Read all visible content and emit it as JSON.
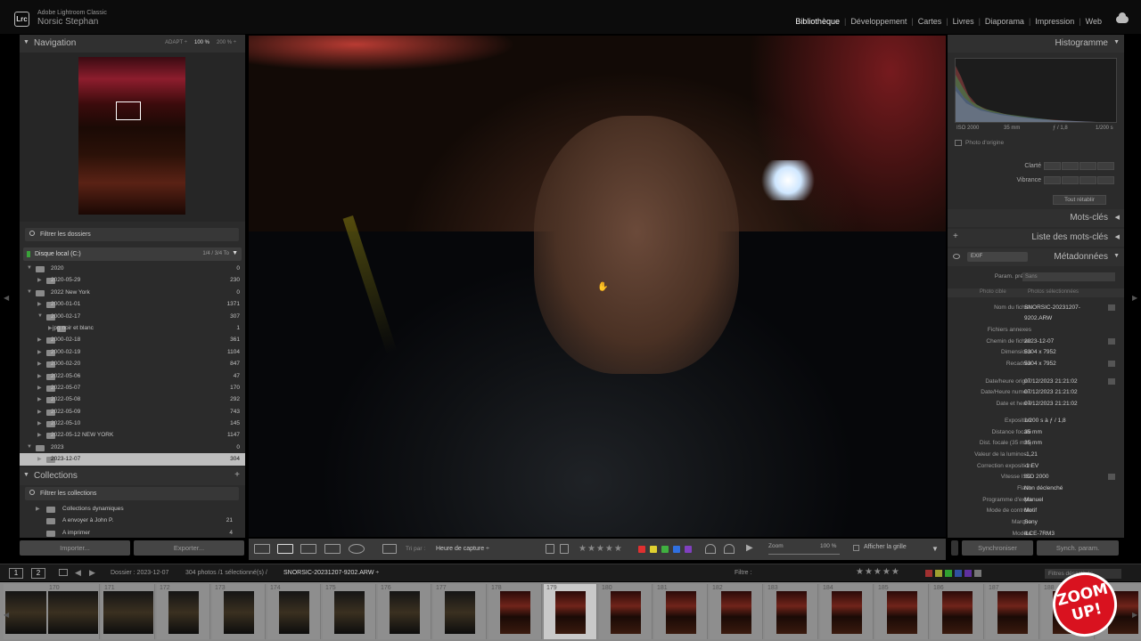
{
  "app": {
    "logo": "Lrc",
    "name": "Adobe Lightroom Classic",
    "user": "Norsic Stephan"
  },
  "modules": [
    {
      "label": "Bibliothèque",
      "active": true
    },
    {
      "label": "Développement",
      "active": false
    },
    {
      "label": "Cartes",
      "active": false
    },
    {
      "label": "Livres",
      "active": false
    },
    {
      "label": "Diaporama",
      "active": false
    },
    {
      "label": "Impression",
      "active": false
    },
    {
      "label": "Web",
      "active": false
    }
  ],
  "navigator": {
    "title": "Navigation",
    "zoom_options": [
      "ADAPT ÷",
      "100 %",
      "200 % ÷"
    ]
  },
  "folders": {
    "filter_placeholder": "Filtrer les dossiers",
    "disk": {
      "label": "Disque local (C:)",
      "size": "1/4 / 3/4 To"
    },
    "rows": [
      {
        "name": "2020",
        "count": "0",
        "level": 0,
        "expanded": true
      },
      {
        "name": "2020-05-29",
        "count": "230",
        "level": 1,
        "expanded": false
      },
      {
        "name": "2022 New York",
        "count": "0",
        "level": 0,
        "expanded": true
      },
      {
        "name": "2000-01-01",
        "count": "1371",
        "level": 1,
        "expanded": false
      },
      {
        "name": "2000-02-17",
        "count": "307",
        "level": 1,
        "expanded": true
      },
      {
        "name": "jpg noir et blanc",
        "count": "1",
        "level": 2,
        "expanded": false
      },
      {
        "name": "2000-02-18",
        "count": "361",
        "level": 1,
        "expanded": false
      },
      {
        "name": "2000-02-19",
        "count": "1104",
        "level": 1,
        "expanded": false
      },
      {
        "name": "2000-02-20",
        "count": "847",
        "level": 1,
        "expanded": false
      },
      {
        "name": "2022-05-06",
        "count": "47",
        "level": 1,
        "expanded": false
      },
      {
        "name": "2022-05-07",
        "count": "170",
        "level": 1,
        "expanded": false
      },
      {
        "name": "2022-05-08",
        "count": "292",
        "level": 1,
        "expanded": false
      },
      {
        "name": "2022-05-09",
        "count": "743",
        "level": 1,
        "expanded": false
      },
      {
        "name": "2022-05-10",
        "count": "145",
        "level": 1,
        "expanded": false
      },
      {
        "name": "2022-05-12 NEW YORK",
        "count": "1147",
        "level": 1,
        "expanded": false
      },
      {
        "name": "2023",
        "count": "0",
        "level": 0,
        "expanded": true
      },
      {
        "name": "2023-12-07",
        "count": "304",
        "level": 1,
        "expanded": false,
        "selected": true
      }
    ]
  },
  "collections": {
    "title": "Collections",
    "filter_placeholder": "Filtrer les collections",
    "rows": [
      {
        "name": "Collections dynamiques",
        "count": ""
      },
      {
        "name": "A envoyer à John P.",
        "count": "21"
      },
      {
        "name": "A imprimer",
        "count": "4"
      }
    ]
  },
  "left_buttons": {
    "import": "Importer...",
    "export": "Exporter..."
  },
  "toolbar": {
    "sort_label": "Tri par :",
    "sort_value": "Heure de capture ÷",
    "stars": "★★★★★",
    "zoom_label": "Zoom",
    "zoom_value": "100 %",
    "grid_label": "Afficher la grille",
    "label_colors": [
      "#e03030",
      "#e0d030",
      "#40b040",
      "#3070e0",
      "#8040c0"
    ]
  },
  "histogram": {
    "title": "Histogramme",
    "iso": "ISO 2000",
    "focal": "35 mm",
    "aperture": "ƒ / 1,8",
    "shutter": "1/200 s",
    "original_label": "Photo d'origine"
  },
  "quick_develop": {
    "rows": [
      {
        "label": "Clarté"
      },
      {
        "label": "Vibrance"
      }
    ],
    "reset": "Tout rétablir"
  },
  "keywords": {
    "title": "Mots-clés"
  },
  "keyword_list": {
    "title": "Liste des mots-clés"
  },
  "metadata": {
    "title": "Métadonnées",
    "set": "EXIF",
    "preset_label": "Param. prédéf",
    "preset_value": "Sans",
    "tab_photo": "Photo cible",
    "tab_selected": "Photos sélectionnées",
    "rows": [
      {
        "k": "Nom du fichier",
        "v": "SNORSIC-20231207-",
        "btn": true
      },
      {
        "k": "",
        "v": "9202.ARW",
        "btn": false
      },
      {
        "k": "Fichiers annexes",
        "v": "",
        "btn": false
      },
      {
        "k": "Chemin de fichier",
        "v": "2023-12-07",
        "btn": true
      },
      {
        "k": "Dimensions",
        "v": "5304 x 7952",
        "btn": false
      },
      {
        "k": "Recadrée",
        "v": "5304 x 7952",
        "btn": true
      },
      {
        "k": "Date/heure origin.",
        "v": "07/12/2023 21:21:02",
        "btn": true
      },
      {
        "k": "Date/Heure numéri.",
        "v": "07/12/2023 21:21:02",
        "btn": false
      },
      {
        "k": "Date et heure",
        "v": "07/12/2023 21:21:02",
        "btn": false
      },
      {
        "k": "Exposition",
        "v": "1/200 s à ƒ / 1,8",
        "btn": false
      },
      {
        "k": "Distance focale",
        "v": "35 mm",
        "btn": false
      },
      {
        "k": "Dist. focale (35 mm)",
        "v": "35 mm",
        "btn": false
      },
      {
        "k": "Valeur de la luminos...",
        "v": "-1,21",
        "btn": false
      },
      {
        "k": "Correction exposition",
        "v": "-1 EV",
        "btn": false
      },
      {
        "k": "Vitesse ISO",
        "v": "ISO 2000",
        "btn": true
      },
      {
        "k": "Flash",
        "v": "Non déclenché",
        "btn": false
      },
      {
        "k": "Programme d'expo",
        "v": "Manuel",
        "btn": false
      },
      {
        "k": "Mode de contrôle",
        "v": "Motif",
        "btn": false
      },
      {
        "k": "Marque",
        "v": "Sony",
        "btn": false
      },
      {
        "k": "Modèle",
        "v": "ILCE-7RM3",
        "btn": false
      }
    ]
  },
  "right_buttons": {
    "sync": "Synchroniser",
    "sync_params": "Synch. param."
  },
  "filmstrip_bar": {
    "view1": "1",
    "view2": "2",
    "folder": "Dossier : 2023-12-07",
    "count": "304 photos /1 sélectionné(s) /",
    "file": "SNORSIC-20231207-9202.ARW ÷",
    "filter_label": "Filtre :",
    "filter_value": "Filtres désactivés",
    "stars": "★★★★★"
  },
  "filmstrip": {
    "cells": [
      {
        "num": "",
        "dark": true
      },
      {
        "num": "170",
        "dark": true
      },
      {
        "num": "171",
        "dark": true
      },
      {
        "num": "172",
        "dark": true
      },
      {
        "num": "173",
        "dark": true
      },
      {
        "num": "174",
        "dark": true
      },
      {
        "num": "175",
        "dark": true
      },
      {
        "num": "176",
        "dark": true
      },
      {
        "num": "177",
        "dark": true
      },
      {
        "num": "178",
        "dark": false
      },
      {
        "num": "179",
        "dark": false,
        "selected": true
      },
      {
        "num": "180",
        "dark": false
      },
      {
        "num": "181",
        "dark": false
      },
      {
        "num": "182",
        "dark": false
      },
      {
        "num": "183",
        "dark": false
      },
      {
        "num": "184",
        "dark": false
      },
      {
        "num": "185",
        "dark": false
      },
      {
        "num": "186",
        "dark": false
      },
      {
        "num": "187",
        "dark": false
      },
      {
        "num": "188",
        "dark": false
      },
      {
        "num": "189",
        "dark": false
      }
    ]
  },
  "watermark": {
    "line1": "ZOOM",
    "line2": "UP!"
  }
}
